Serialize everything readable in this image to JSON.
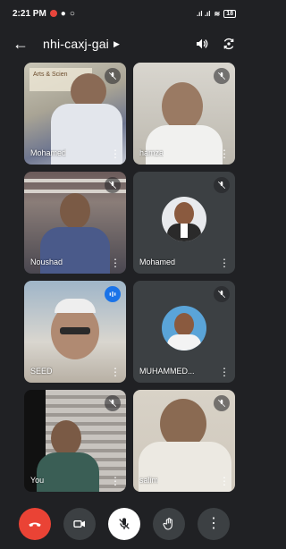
{
  "status": {
    "time": "2:21 PM",
    "battery": "18"
  },
  "header": {
    "meeting_code": "nhi-caxj-gai"
  },
  "participants": [
    {
      "name": "Mohamed"
    },
    {
      "name": "hamza"
    },
    {
      "name": "Noushad"
    },
    {
      "name": "Mohamed"
    },
    {
      "name": "SEED"
    },
    {
      "name": "MUHAMMED..."
    },
    {
      "name": "You"
    },
    {
      "name": "salim"
    }
  ],
  "tile_backdrop_text": "Arts & Scien",
  "icons": {
    "back": "arrow-left-icon",
    "speaker": "speaker-icon",
    "switch_camera": "switch-camera-icon",
    "mic_off": "mic-off-icon",
    "more": "more-vert-icon",
    "end_call": "end-call-icon",
    "camera": "videocam-icon",
    "raise_hand": "hand-icon"
  },
  "colors": {
    "end_call": "#ea4335",
    "speaking": "#1a73e8",
    "background": "#202124"
  }
}
